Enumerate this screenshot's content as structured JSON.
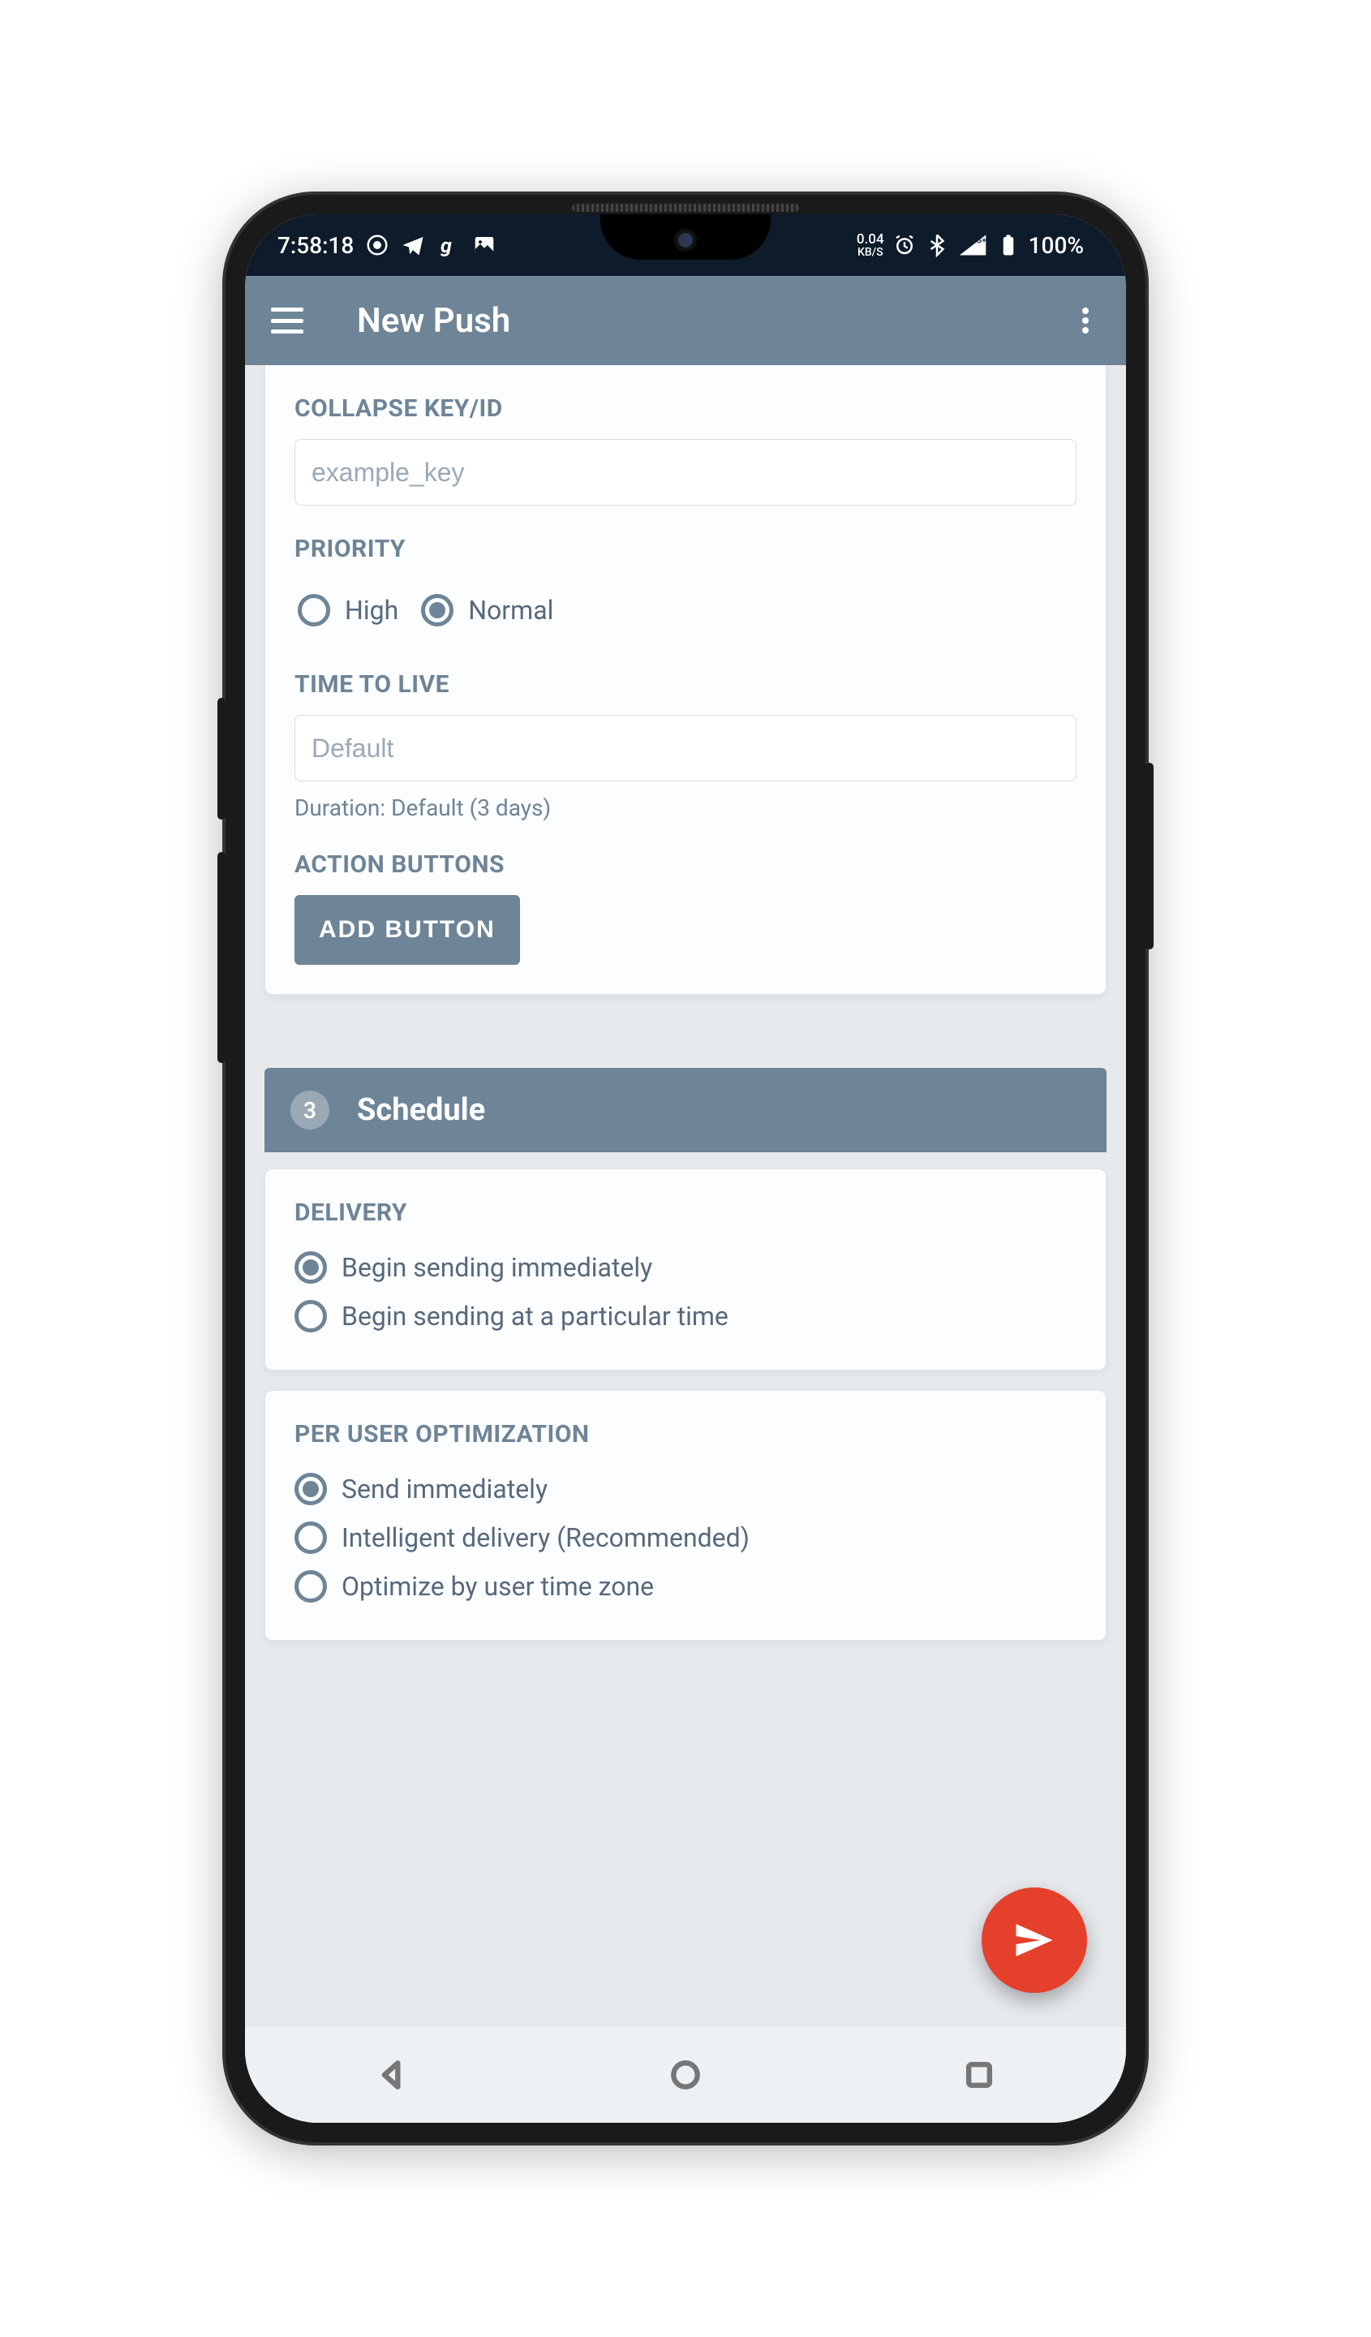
{
  "statusbar": {
    "time": "7:58:18",
    "net_speed": "0.04",
    "net_unit": "KB/S",
    "signal": "4G+",
    "battery": "100%"
  },
  "appbar": {
    "title": "New Push"
  },
  "collapse": {
    "label": "COLLAPSE KEY/ID",
    "placeholder": "example_key"
  },
  "priority": {
    "label": "PRIORITY",
    "options": {
      "high": "High",
      "normal": "Normal"
    },
    "selected": "normal"
  },
  "ttl": {
    "label": "TIME TO LIVE",
    "placeholder": "Default",
    "helper": "Duration: Default (3 days)"
  },
  "action_buttons": {
    "label": "ACTION BUTTONS",
    "add_label": "ADD BUTTON"
  },
  "schedule": {
    "step_number": "3",
    "title": "Schedule"
  },
  "delivery": {
    "label": "DELIVERY",
    "options": {
      "immediate": "Begin sending immediately",
      "later": "Begin sending at a particular time"
    },
    "selected": "immediate"
  },
  "per_user": {
    "label": "PER USER OPTIMIZATION",
    "options": {
      "immediate": "Send immediately",
      "intelligent": "Intelligent delivery (Recommended)",
      "timezone": "Optimize by user time zone"
    },
    "selected": "immediate"
  }
}
